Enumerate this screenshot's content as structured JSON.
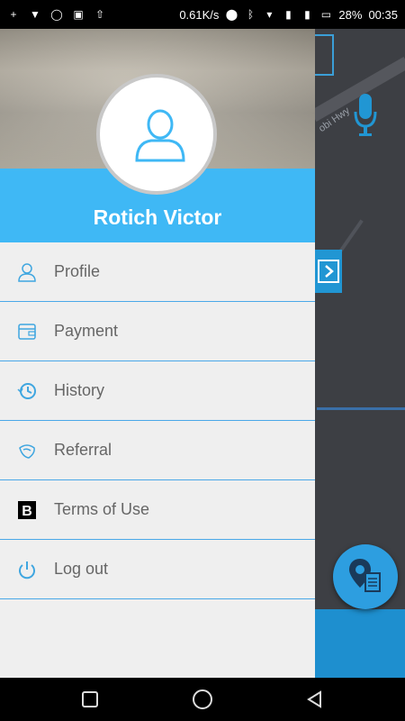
{
  "status_bar": {
    "speed": "0.61K/s",
    "battery": "28%",
    "time": "00:35"
  },
  "map": {
    "road_label": "obi Hwy"
  },
  "drawer": {
    "user_name": "Rotich Victor",
    "menu": [
      {
        "label": "Profile",
        "icon": "person-icon"
      },
      {
        "label": "Payment",
        "icon": "wallet-icon"
      },
      {
        "label": "History",
        "icon": "history-icon"
      },
      {
        "label": "Referral",
        "icon": "referral-icon"
      },
      {
        "label": "Terms of Use",
        "icon": "terms-b-icon"
      },
      {
        "label": "Log out",
        "icon": "power-icon"
      }
    ]
  },
  "colors": {
    "accent": "#3fb8f5",
    "divider": "#4aa8e8",
    "map_button": "#2196d3"
  }
}
